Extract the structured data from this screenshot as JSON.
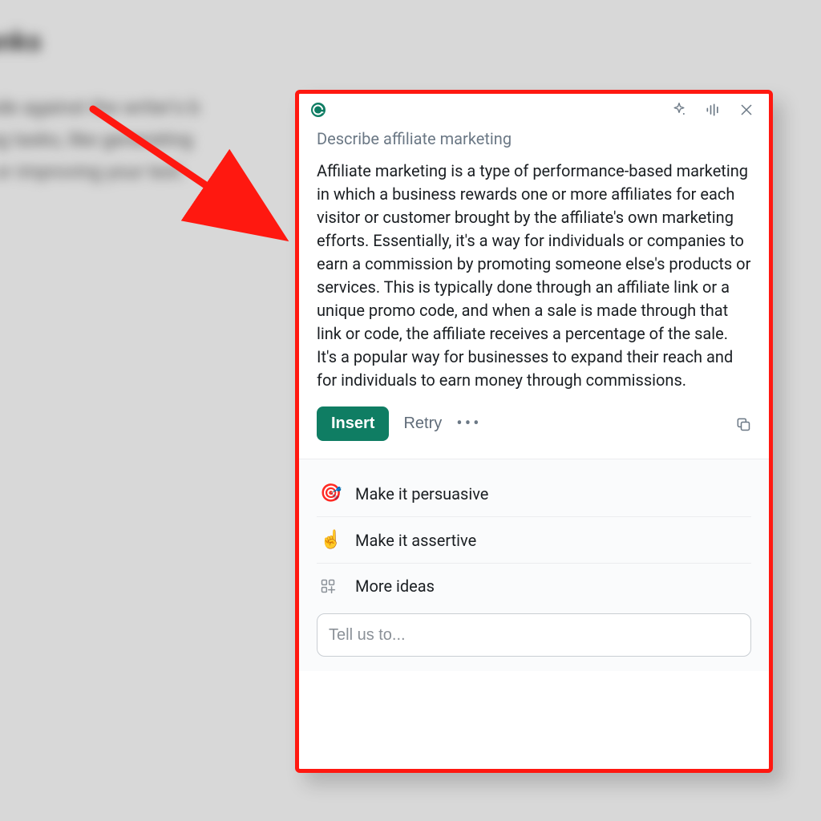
{
  "background": {
    "title": "lanks",
    "para_line1": "code against the writer's b",
    "para_line2": "ting tasks, like generating",
    "para_line3": "s, or improving your text."
  },
  "header": {
    "brand": "Grammarly"
  },
  "panel": {
    "prompt_label": "Describe affiliate marketing",
    "generated_text": "Affiliate marketing is a type of performance-based marketing in which a business rewards one or more affiliates for each visitor or customer brought by the affiliate's own marketing efforts. Essentially, it's a way for individuals or companies to earn a commission by promoting someone else's products or services. This is typically done through an affiliate link or a unique promo code, and when a sale is made through that link or code, the affiliate receives a percentage of the sale. It's a popular way for businesses to expand their reach and for individuals to earn money through commissions.",
    "insert_label": "Insert",
    "retry_label": "Retry"
  },
  "suggestions": {
    "items": [
      {
        "emoji": "🎯",
        "label": "Make it persuasive"
      },
      {
        "emoji": "☝️",
        "label": "Make it assertive"
      },
      {
        "emoji": "",
        "label": "More ideas"
      }
    ]
  },
  "input": {
    "placeholder": "Tell us to..."
  },
  "colors": {
    "accent": "#0f7d63",
    "annotation": "#ff1810"
  }
}
